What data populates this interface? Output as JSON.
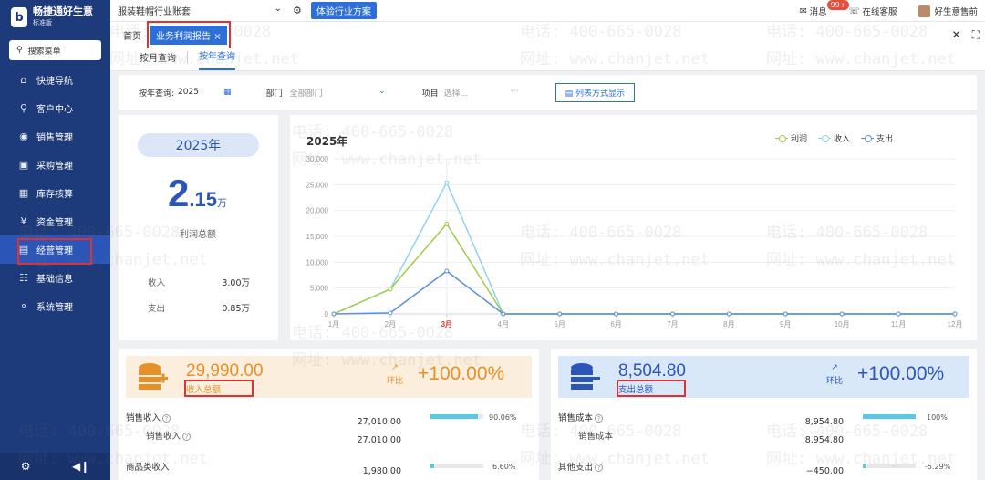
{
  "brand": {
    "name": "畅捷通好生意",
    "edition": "标准版",
    "logo_glyph": "b"
  },
  "sidebar": {
    "search_label": "搜索菜单",
    "items": [
      {
        "label": "快捷导航",
        "icon": "home-icon"
      },
      {
        "label": "客户中心",
        "icon": "location-icon"
      },
      {
        "label": "销售管理",
        "icon": "sales-icon"
      },
      {
        "label": "采购管理",
        "icon": "bag-icon"
      },
      {
        "label": "库存核算",
        "icon": "warehouse-icon"
      },
      {
        "label": "资金管理",
        "icon": "money-icon"
      },
      {
        "label": "经营管理",
        "icon": "chart-icon",
        "active": true
      },
      {
        "label": "基础信息",
        "icon": "card-icon"
      },
      {
        "label": "系统管理",
        "icon": "system-icon"
      }
    ]
  },
  "topbar": {
    "account": "服装鞋帽行业账套",
    "trial_button": "体验行业方案",
    "messages_label": "消息",
    "messages_badge": "99+",
    "support_label": "在线客服",
    "user_name": "好生意售前"
  },
  "tabs": {
    "home": "首页",
    "active": "业务利润报告",
    "close_glyph": "×"
  },
  "subtabs": [
    "按月查询",
    "按年查询"
  ],
  "filters": {
    "year_label": "按年查询:",
    "year_value": "2025",
    "dept_label": "部门",
    "dept_value": "全部部门",
    "project_label": "项目",
    "project_placeholder": "选择...",
    "list_button": "列表方式显示"
  },
  "summary": {
    "year_pill": "2025年",
    "big_int": "2",
    "big_dec": ".15",
    "big_unit": "万",
    "big_label": "利润总额",
    "income_label": "收入",
    "income_value": "3.00万",
    "expense_label": "支出",
    "expense_value": "0.85万"
  },
  "chart_data": {
    "type": "line",
    "title": "2025年",
    "categories": [
      "1月",
      "2月",
      "3月",
      "4月",
      "5月",
      "6月",
      "7月",
      "8月",
      "9月",
      "10月",
      "11月",
      "12月"
    ],
    "highlight_category": "3月",
    "ylim": [
      0,
      30000
    ],
    "yticks": [
      "0",
      "5,000",
      "10,000",
      "15,000",
      "20,000",
      "25,000",
      "30,000"
    ],
    "ytick_values": [
      0,
      5000,
      10000,
      15000,
      20000,
      25000,
      30000
    ],
    "series": [
      {
        "name": "利润",
        "color": "#9fcc4a",
        "values": [
          0,
          4800,
          17400,
          0,
          0,
          0,
          0,
          0,
          0,
          0,
          0,
          0
        ]
      },
      {
        "name": "收入",
        "color": "#8fd3ef",
        "values": [
          0,
          4800,
          25400,
          0,
          0,
          0,
          0,
          0,
          0,
          0,
          0,
          0
        ]
      },
      {
        "name": "支出",
        "color": "#5b8fd6",
        "values": [
          0,
          200,
          8300,
          0,
          0,
          0,
          0,
          0,
          0,
          0,
          0,
          0
        ]
      }
    ],
    "legend_position": "top-right",
    "grid": true
  },
  "income_card": {
    "amount": "29,990.00",
    "label": "收入总额",
    "ring_label": "环比",
    "ring_pct": "+100.00%",
    "rows": [
      {
        "name": "销售收入",
        "help": true,
        "amount": "27,010.00",
        "pct": "90.06%",
        "ratio": 0.9006
      },
      {
        "name": "销售收入",
        "help": true,
        "sub": true,
        "amount": "27,010.00"
      },
      {
        "name": "商品类收入",
        "amount": "1,980.00",
        "pct": "6.60%",
        "ratio": 0.066
      }
    ]
  },
  "expense_card": {
    "amount": "8,504.80",
    "label": "支出总额",
    "ring_label": "环比",
    "ring_pct": "+100.00%",
    "rows": [
      {
        "name": "销售成本",
        "help": true,
        "amount": "8,954.80",
        "pct": "100%",
        "ratio": 1.0
      },
      {
        "name": "销售成本",
        "help": true,
        "sub": true,
        "amount": "8,954.80"
      },
      {
        "name": "其他支出",
        "help": true,
        "amount": "−450.00",
        "pct": "-5.29%",
        "ratio": 0.0529
      }
    ]
  },
  "watermark": {
    "phone": "电话: 400-665-0028",
    "site": "网址: www.chanjet.net"
  }
}
